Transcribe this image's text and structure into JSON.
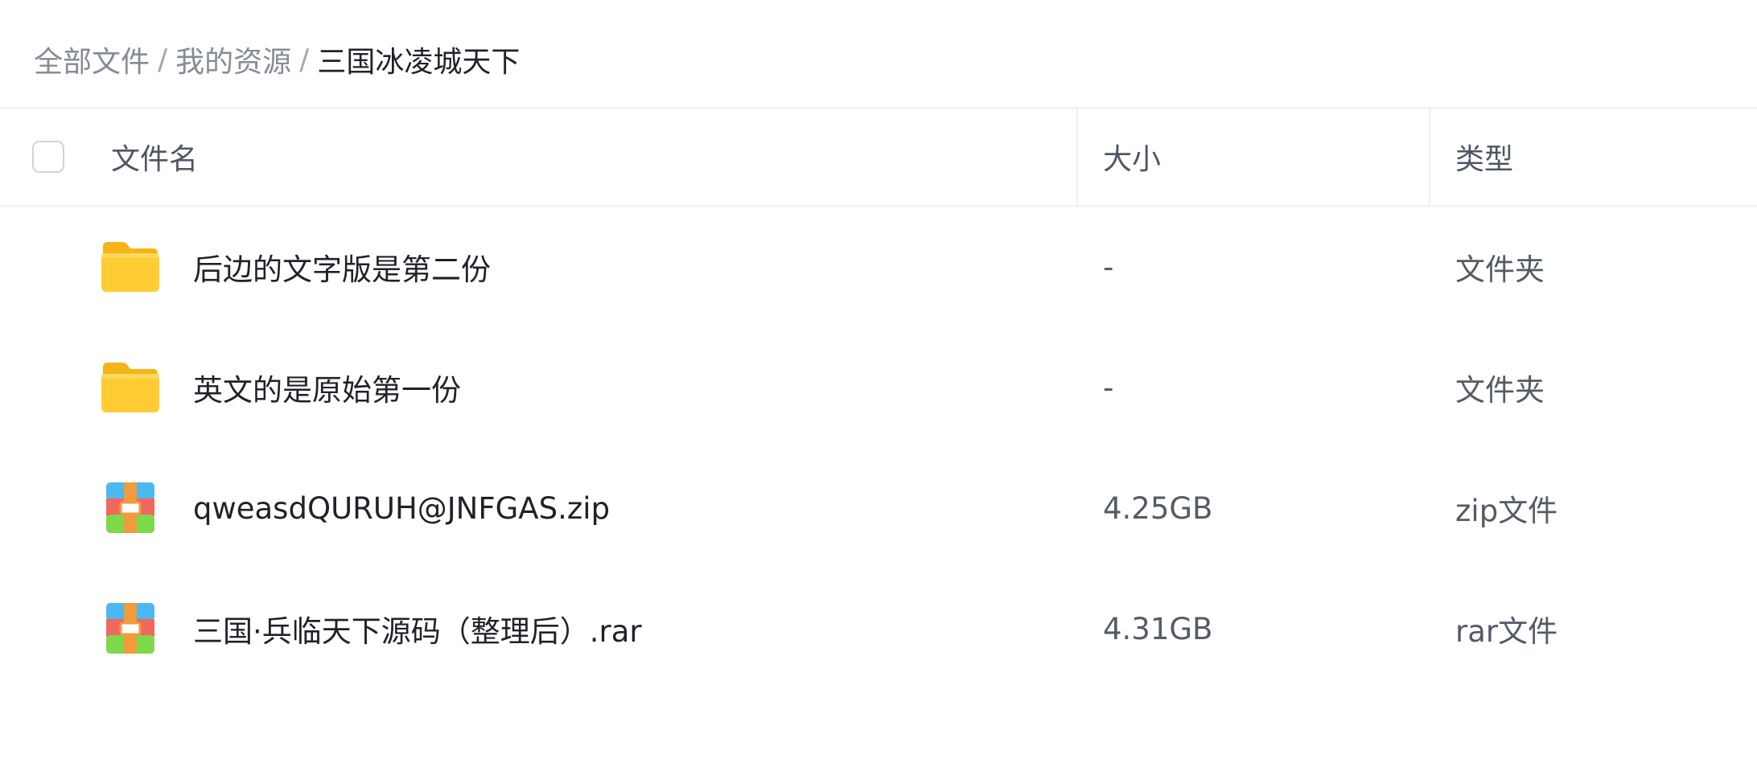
{
  "breadcrumb": {
    "items": [
      "全部文件",
      "我的资源"
    ],
    "separator": "/",
    "current": "三国冰凌城天下"
  },
  "table": {
    "columns": {
      "name": "文件名",
      "size": "大小",
      "type": "类型"
    },
    "rows": [
      {
        "icon": "folder-icon",
        "name": "后边的文字版是第二份",
        "size": "-",
        "type": "文件夹"
      },
      {
        "icon": "folder-icon",
        "name": "英文的是原始第一份",
        "size": "-",
        "type": "文件夹"
      },
      {
        "icon": "archive-icon",
        "name": "qweasdQURUH@JNFGAS.zip",
        "size": "4.25GB",
        "type": "zip文件"
      },
      {
        "icon": "archive-icon",
        "name": "三国·兵临天下源码（整理后）.rar",
        "size": "4.31GB",
        "type": "rar文件"
      }
    ]
  },
  "colors": {
    "folder": "#ffc933",
    "archive_top": "#4db8f0",
    "archive_mid": "#f0675e",
    "archive_bottom": "#7dd84a",
    "archive_strap": "#f39a3a"
  }
}
